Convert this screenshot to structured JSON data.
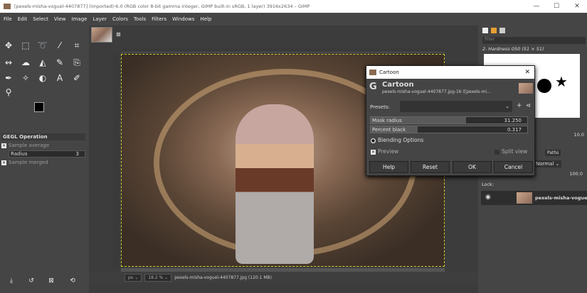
{
  "window": {
    "title": "[pexels-misha-voguel-4407877] (imported)-6.0 (RGB color 8-bit gamma integer, GIMP built-in sRGB, 1 layer) 3916x2634 – GIMP",
    "minimize": "—",
    "maximize": "☐",
    "close": "✕"
  },
  "menu": [
    "File",
    "Edit",
    "Select",
    "View",
    "Image",
    "Layer",
    "Colors",
    "Tools",
    "Filters",
    "Windows",
    "Help"
  ],
  "tool_options": {
    "title": "GEGL Operation",
    "sample_average": "Sample average",
    "radius_label": "Radius",
    "radius_value": "3",
    "sample_merged": "Sample merged"
  },
  "status": {
    "unit": "px",
    "zoom": "18.2 %",
    "info": "pexels-misha-voguel-4407877.jpg (120.1 MB)"
  },
  "brushes": {
    "filter_placeholder": "filter",
    "brush_name": "2. Hardness 050 (51 × 51)",
    "spacing": "10.0"
  },
  "layers": {
    "tabs_label": "Paths",
    "mode": "Normal",
    "opacity": "100.0",
    "lock_label": "Lock:",
    "layer_name": "pexels-misha-voguel"
  },
  "dialog": {
    "window_title": "Cartoon",
    "heading": "Cartoon",
    "subtitle": "pexels-misha-voguel-4407877.jpg-16 ([pexels-mi...",
    "presets_label": "Presets:",
    "mask_radius_label": "Mask radius",
    "mask_radius_value": "31.250",
    "percent_black_label": "Percent black",
    "percent_black_value": "0.317",
    "blending_options": "Blending Options",
    "preview": "Preview",
    "split_view": "Split view",
    "buttons": {
      "help": "Help",
      "reset": "Reset",
      "ok": "OK",
      "cancel": "Cancel"
    }
  }
}
